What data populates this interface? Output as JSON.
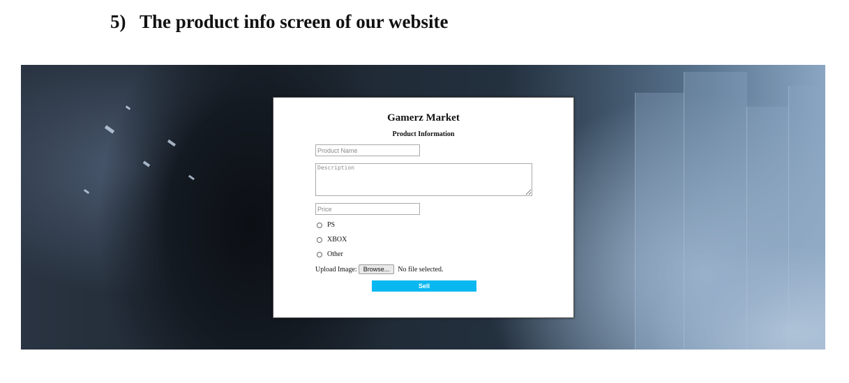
{
  "document": {
    "heading_number": "5)",
    "heading_text": "The product info screen of our website"
  },
  "form": {
    "title": "Gamerz Market",
    "subtitle": "Product Information",
    "product_name_placeholder": "Product Name",
    "description_placeholder": "Description",
    "price_placeholder": "Price",
    "platforms": [
      {
        "label": "PS",
        "selected": false
      },
      {
        "label": "XBOX",
        "selected": false
      },
      {
        "label": "Other",
        "selected": false
      }
    ],
    "upload_label": "Upload Image:",
    "browse_label": "Browse...",
    "file_status": "No file selected.",
    "sell_label": "Sell"
  },
  "colors": {
    "sell_button": "#0ab8f1",
    "card_background": "#ffffff"
  }
}
